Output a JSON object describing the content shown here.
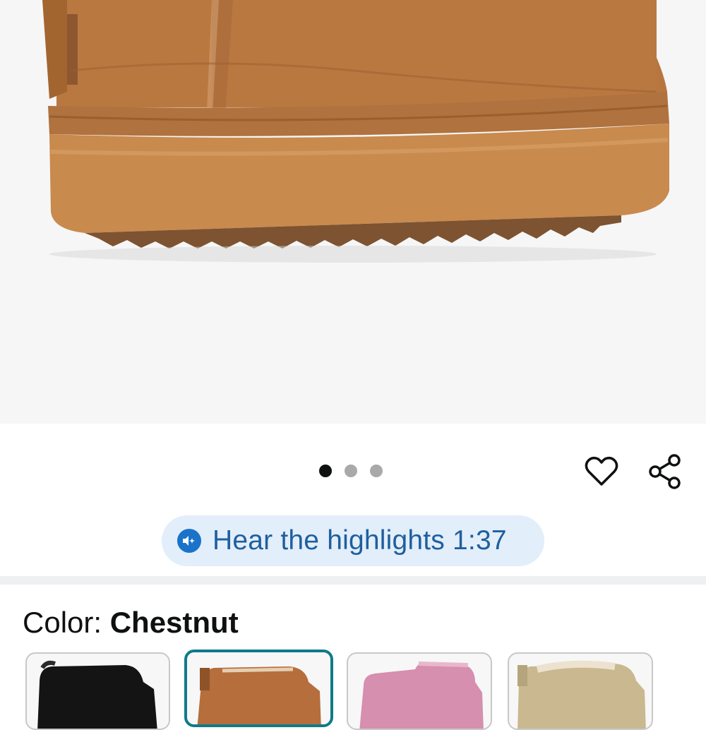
{
  "product": {
    "image_carousel": {
      "pages": 3,
      "active_index": 0
    },
    "actions": {
      "favorite_icon": "heart-outline-icon",
      "share_icon": "share-icon"
    },
    "audio_summary": {
      "label": "Hear the highlights 1:37",
      "icon": "audio-sparkle-icon"
    },
    "color": {
      "prefix": "Color: ",
      "selected": "Chestnut",
      "options": [
        {
          "name": "Black",
          "hex": "#111111"
        },
        {
          "name": "Chestnut",
          "hex": "#b66e3c"
        },
        {
          "name": "Pink",
          "hex": "#d68fae"
        },
        {
          "name": "Sand",
          "hex": "#c9b890"
        }
      ]
    }
  },
  "colors": {
    "accent_blue": "#1a73c9",
    "pill_bg": "#e2eefa",
    "selected_border": "#0f7a8a",
    "boot_suede": "#b8763f",
    "boot_sole": "#c98a4e"
  }
}
